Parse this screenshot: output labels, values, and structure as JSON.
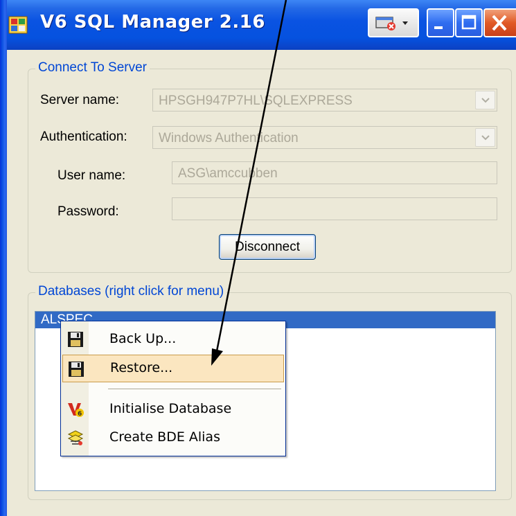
{
  "window": {
    "title": "V6 SQL Manager  2.16"
  },
  "connect": {
    "group_label": "Connect To Server",
    "server_label": "Server name:",
    "server_value": "HPSGH947P7HL\\SQLEXPRESS",
    "auth_label": "Authentication:",
    "auth_value": "Windows Authentication",
    "user_label": "User name:",
    "user_value": "ASG\\amccubben",
    "password_label": "Password:",
    "password_value": "",
    "disconnect_label": "Disconnect"
  },
  "databases": {
    "group_label": "Databases (right click for menu)",
    "items": [
      "ALSPEC"
    ]
  },
  "context_menu": {
    "items": [
      {
        "label": "Back Up...",
        "icon": "floppy-disk-icon"
      },
      {
        "label": "Restore...",
        "icon": "floppy-disk-icon",
        "highlighted": true
      },
      {
        "label": "Initialise Database",
        "icon": "v6-logo-icon"
      },
      {
        "label": "Create BDE Alias",
        "icon": "alias-icon"
      }
    ]
  },
  "colors": {
    "titlebar": "#0a53e2",
    "group_label": "#0046d5",
    "selection": "#316ac5",
    "menu_highlight": "#fbe6c0"
  }
}
